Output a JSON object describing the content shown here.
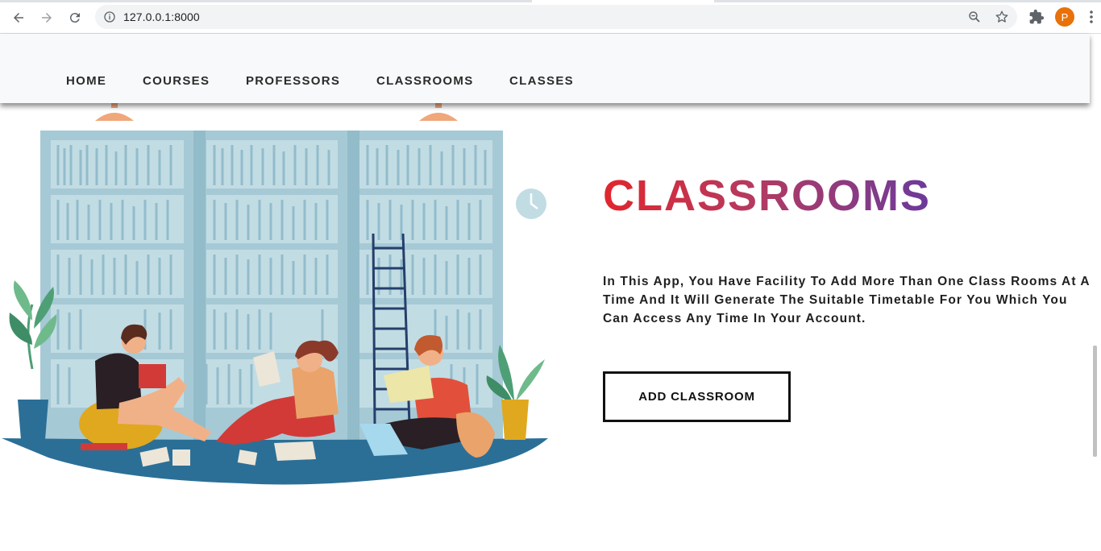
{
  "browser": {
    "url": "127.0.0.1:8000",
    "profile_initial": "P",
    "accent": "#e8710a"
  },
  "nav": {
    "items": [
      {
        "label": "HOME"
      },
      {
        "label": "COURSES"
      },
      {
        "label": "PROFESSORS"
      },
      {
        "label": "CLASSROOMS"
      },
      {
        "label": "CLASSES"
      }
    ]
  },
  "hero": {
    "title": "CLASSROOMS",
    "description": "In This App, You Have Facility To Add More Than One Class Rooms At A Time And It Will Generate The Suitable Timetable For You Which You Can Access Any Time In Your Account.",
    "button_label": "ADD CLASSROOM",
    "title_gradient": [
      "#e1262d",
      "#b53a60",
      "#6b3a9b"
    ]
  }
}
